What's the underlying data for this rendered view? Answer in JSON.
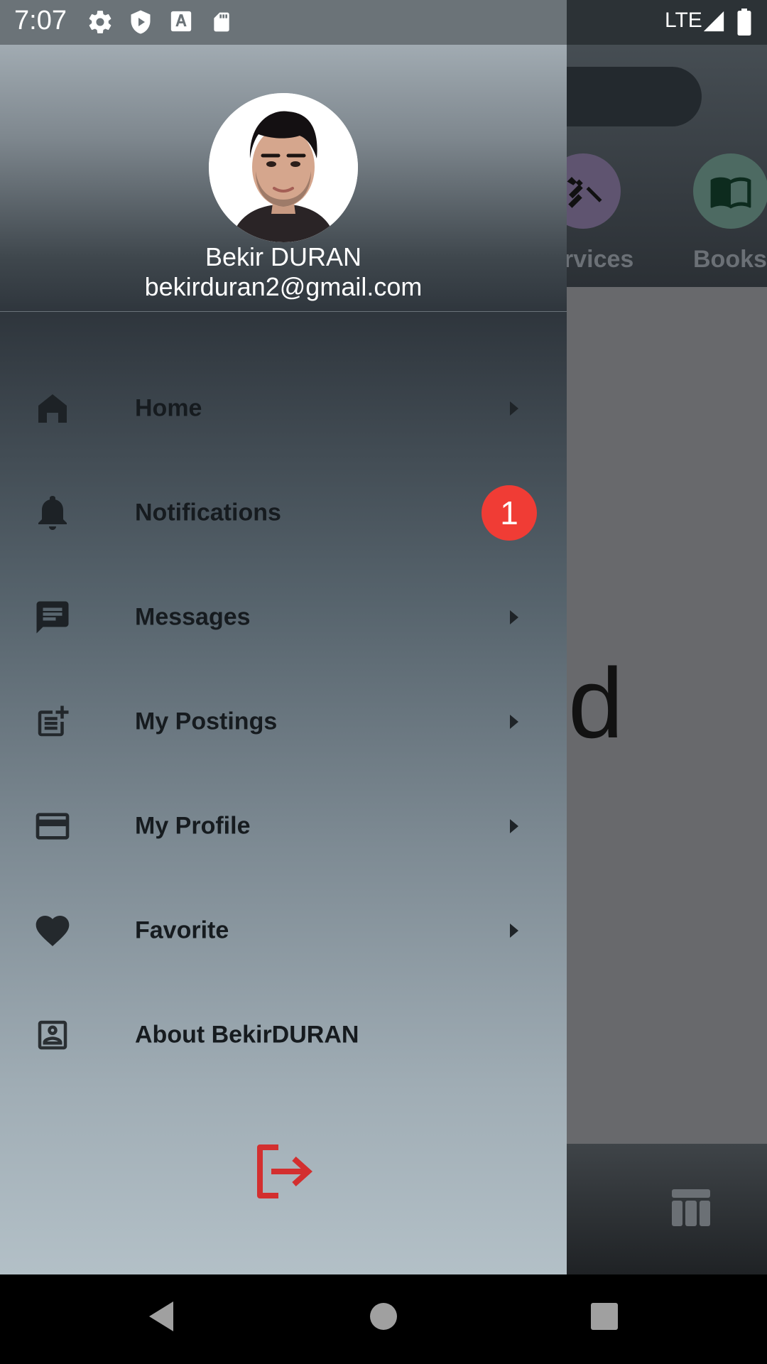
{
  "status_bar": {
    "time": "7:07",
    "network": "LTE",
    "icons": [
      "gear-icon",
      "shield-play-icon",
      "text-a-icon",
      "sd-card-icon",
      "signal-icon",
      "battery-icon"
    ]
  },
  "background_app": {
    "categories": [
      {
        "label": "rvices",
        "icon": "tools-icon",
        "color": "#5f5470"
      },
      {
        "label": "Books",
        "icon": "book-icon",
        "color": "#4d6a62"
      }
    ],
    "content_letter": "d"
  },
  "drawer": {
    "user": {
      "name": "Bekir DURAN",
      "email": "bekirduran2@gmail.com"
    },
    "menu": [
      {
        "label": "Home",
        "icon": "home-icon",
        "arrow": true
      },
      {
        "label": "Notifications",
        "icon": "bell-icon",
        "badge": "1"
      },
      {
        "label": "Messages",
        "icon": "message-icon",
        "arrow": true
      },
      {
        "label": "My Postings",
        "icon": "post-add-icon",
        "arrow": true
      },
      {
        "label": "My Profile",
        "icon": "card-icon",
        "arrow": true
      },
      {
        "label": "Favorite",
        "icon": "heart-icon",
        "arrow": true
      },
      {
        "label": "About BekirDURAN",
        "icon": "contact-icon",
        "arrow": false
      }
    ],
    "logout_icon": "logout-icon"
  },
  "colors": {
    "badge": "#f03c35",
    "logout": "#d32f2f",
    "menu_text": "#161b1f"
  }
}
